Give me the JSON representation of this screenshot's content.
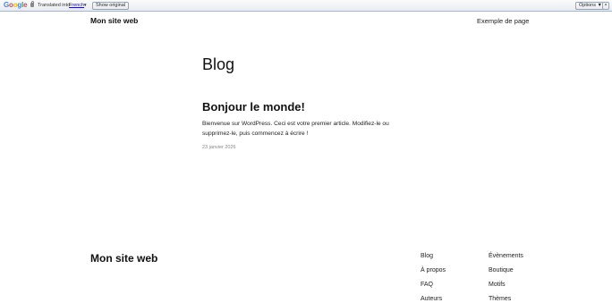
{
  "translate_bar": {
    "logo": [
      "G",
      "o",
      "o",
      "g",
      "l",
      "e"
    ],
    "translated_into": "Translated into:",
    "language": "French",
    "language_arrow": "▼",
    "show_original": "Show original",
    "options": "Options ▼",
    "close": "×"
  },
  "header": {
    "site_title": "Mon site web",
    "nav": [
      "Exemple de page"
    ]
  },
  "main": {
    "page_title": "Blog",
    "post": {
      "title": "Bonjour le monde!",
      "excerpt": "Bienvenue sur WordPress. Ceci est votre premier article. Modifiez-le ou supprimez-le, puis commencez à écrire !",
      "date": "23 janvier 2026"
    }
  },
  "footer": {
    "site_title": "Mon site web",
    "col1": [
      "Blog",
      "À propos",
      "FAQ",
      "Auteurs"
    ],
    "col2": [
      "Évènements",
      "Boutique",
      "Motifs",
      "Thèmes"
    ]
  }
}
